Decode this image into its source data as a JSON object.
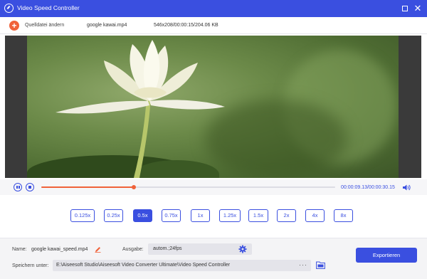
{
  "window": {
    "title": "Video Speed Controller",
    "accent_color": "#3a4fe0",
    "highlight_color": "#f0623a"
  },
  "filebar": {
    "add_label": "Quelldatei ändern",
    "add_icon": "plus-circle-icon",
    "file_name": "google kawai.mp4",
    "file_meta": "546x208/00:00:15/204.06 KB"
  },
  "player": {
    "current_time": "00:00:09.13",
    "total_time": "/00:00:30.15",
    "progress": 0.314
  },
  "speeds": {
    "options": [
      "0.125x",
      "0.25x",
      "0.5x",
      "0.75x",
      "1x",
      "1.25x",
      "1.5x",
      "2x",
      "4x",
      "8x"
    ],
    "selected": "0.5x"
  },
  "output": {
    "name_label": "Name:",
    "name_value": "google kawai_speed.mp4",
    "format_label": "Ausgabe:",
    "format_value": "autom.;24fps",
    "save_label": "Speichern unter:",
    "save_path": "E:\\Aiseesoft Studio\\Aiseesoft Video Converter Ultimate\\Video Speed Controller",
    "browse_label": "···",
    "export_label": "Exportieren"
  }
}
